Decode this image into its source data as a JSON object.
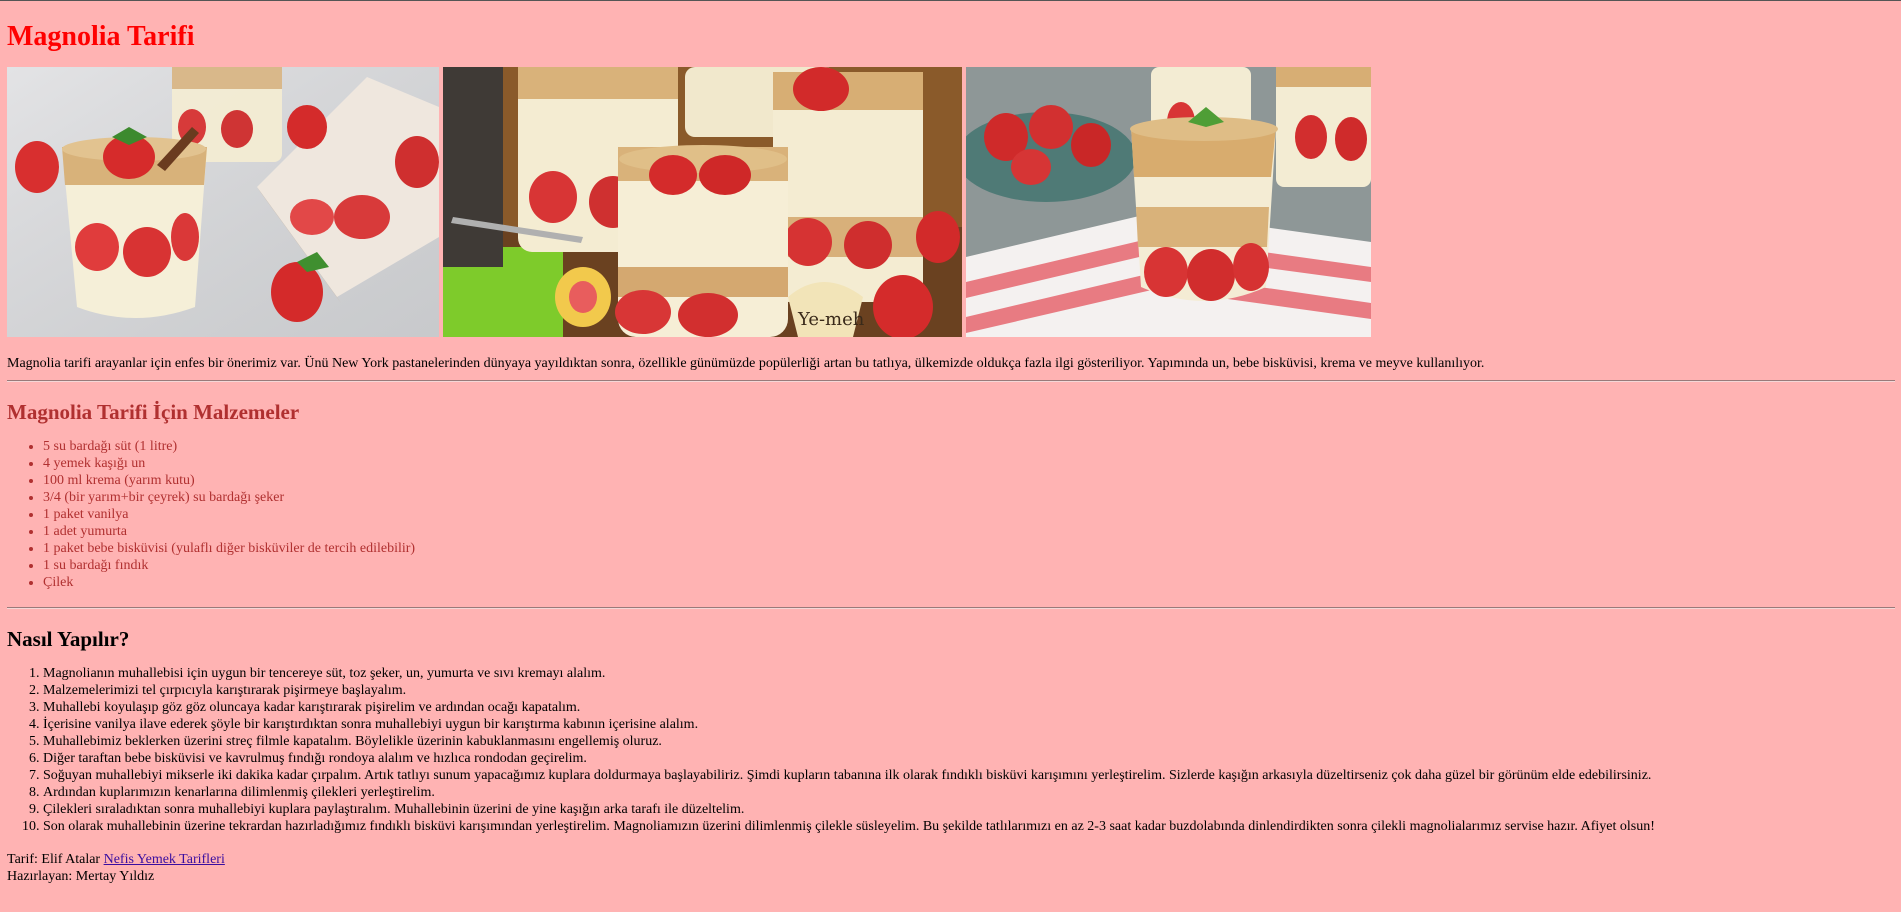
{
  "page": {
    "title": "Magnolia Tarifi",
    "intro": "Magnolia tarifi arayanlar için enfes bir önerimiz var. Ünü New York pastanelerinden dünyaya yayıldıktan sonra, özellikle günümüzde popülerliği artan bu tatlıya, ülkemizde oldukça fazla ilgi gösteriliyor. Yapımında un, bebe bisküvisi, krema ve meyve kullanılıyor."
  },
  "ingredients": {
    "heading": "Magnolia Tarifi İçin Malzemeler",
    "items": [
      "5 su bardağı süt (1 litre)",
      "4 yemek kaşığı un",
      "100 ml krema (yarım kutu)",
      "3/4 (bir yarım+bir çeyrek) su bardağı şeker",
      "1 paket vanilya",
      "1 adet yumurta",
      "1 paket bebe bisküvisi (yulaflı diğer bisküviler de tercih edilebilir)",
      "1 su bardağı fındık",
      "Çilek"
    ]
  },
  "steps": {
    "heading": "Nasıl Yapılır?",
    "items": [
      "Magnolianın muhallebisi için uygun bir tencereye süt, toz şeker, un, yumurta ve sıvı kremayı alalım.",
      "Malzemelerimizi tel çırpıcıyla karıştırarak pişirmeye başlayalım.",
      "Muhallebi koyulaşıp göz göz oluncaya kadar karıştırarak pişirelim ve ardından ocağı kapatalım.",
      "İçerisine vanilya ilave ederek şöyle bir karıştırdıktan sonra muhallebiyi uygun bir karıştırma kabının içerisine alalım.",
      "Muhallebimiz beklerken üzerini streç filmle kapatalım. Böylelikle üzerinin kabuklanmasını engellemiş oluruz.",
      "Diğer taraftan bebe bisküvisi ve kavrulmuş fındığı rondoya alalım ve hızlıca rondodan geçirelim.",
      "Soğuyan muhallebiyi mikserle iki dakika kadar çırpalım. Artık tatlıyı sunum yapacağımız kuplara doldurmaya başlayabiliriz. Şimdi kupların tabanına ilk olarak fındıklı bisküvi karışımını yerleştirelim. Sizlerde kaşığın arkasıyla düzeltirseniz çok daha güzel bir görünüm elde edebilirsiniz.",
      "Ardından kuplarımızın kenarlarına dilimlenmiş çilekleri yerleştirelim.",
      "Çilekleri sıraladıktan sonra muhallebiyi kuplara paylaştıralım. Muhallebinin üzerini de yine kaşığın arka tarafı ile düzeltelim.",
      "Son olarak muhallebinin üzerine tekrardan hazırladığımız fındıklı bisküvi karışımından yerleştirelim. Magnoliamızın üzerini dilimlenmiş çilekle süsleyelim. Bu şekilde tatlılarımızı en az 2-3 saat kadar buzdolabında dinlendirdikten sonra çilekli magnolialarımız servise hazır. Afiyet olsun!"
    ]
  },
  "credits": {
    "recipe_label": "Tarif: Elif Atalar",
    "link_text": "Nefis Yemek Tarifleri",
    "prepared_by": "Hazırlayan: Mertay Yıldız"
  },
  "photos": {
    "photo1_icon": "strawberry-dessert-glass-photo",
    "photo2_icon": "strawberry-dessert-jars-photo",
    "photo3_icon": "strawberry-dessert-cup-photo",
    "jar_label": "Ye-meh"
  },
  "colors": {
    "background": "#ffb3b3",
    "title": "#ff0000",
    "ingredients": "#b03030",
    "link": "#3a0ea0"
  }
}
